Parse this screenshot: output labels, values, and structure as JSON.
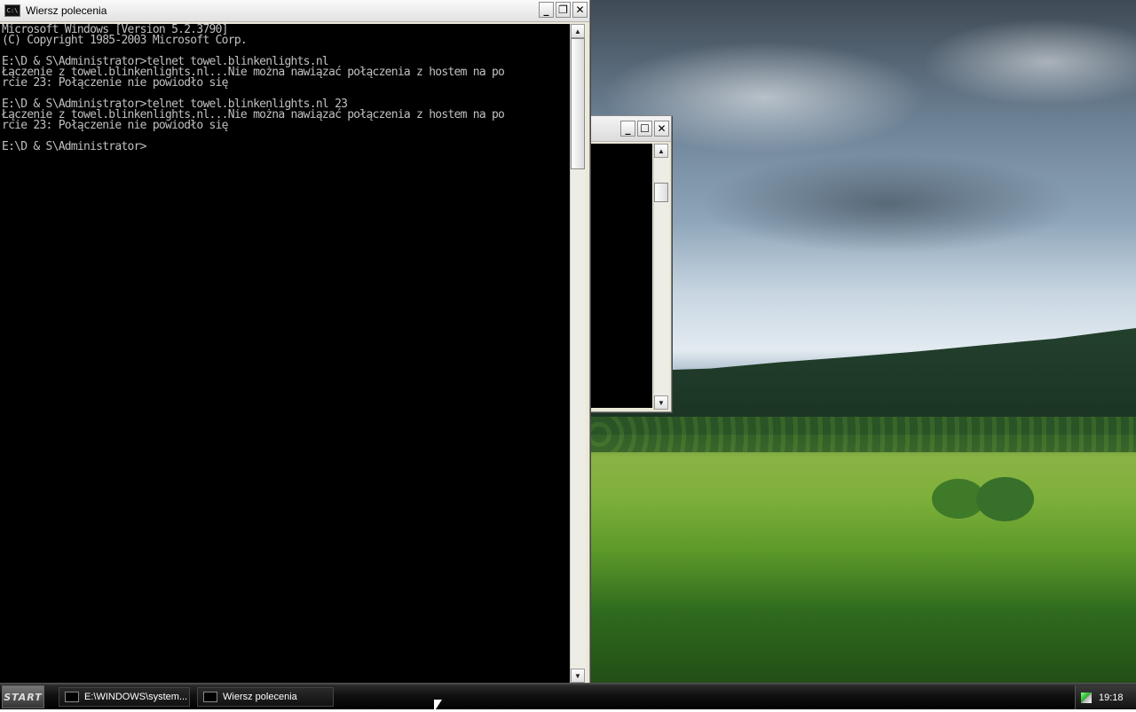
{
  "main_window": {
    "title": "Wiersz polecenia",
    "console_lines": [
      "Microsoft Windows [Version 5.2.3790]",
      "(C) Copyright 1985-2003 Microsoft Corp.",
      "",
      "E:\\D & S\\Administrator>telnet towel.blinkenlights.nl",
      "Łączenie z towel.blinkenlights.nl...Nie można nawiązać połączenia z hostem na po",
      "rcie 23: Połączenie nie powiodło się",
      "",
      "E:\\D & S\\Administrator>telnet towel.blinkenlights.nl 23",
      "Łączenie z towel.blinkenlights.nl...Nie można nawiązać połączenia z hostem na po",
      "rcie 23: Połączenie nie powiodło się",
      "",
      "E:\\D & S\\Administrator>"
    ],
    "buttons": {
      "minimize": "_",
      "restore": "❐",
      "close": "✕"
    }
  },
  "background_window": {
    "buttons": {
      "minimize": "_",
      "maximize": "☐",
      "close": "✕"
    }
  },
  "scroll_arrows": {
    "up": "▲",
    "down": "▼"
  },
  "taskbar": {
    "start_label": "START",
    "items": [
      {
        "label": "E:\\WINDOWS\\system..."
      },
      {
        "label": "Wiersz polecenia"
      }
    ],
    "clock": "19:18"
  }
}
